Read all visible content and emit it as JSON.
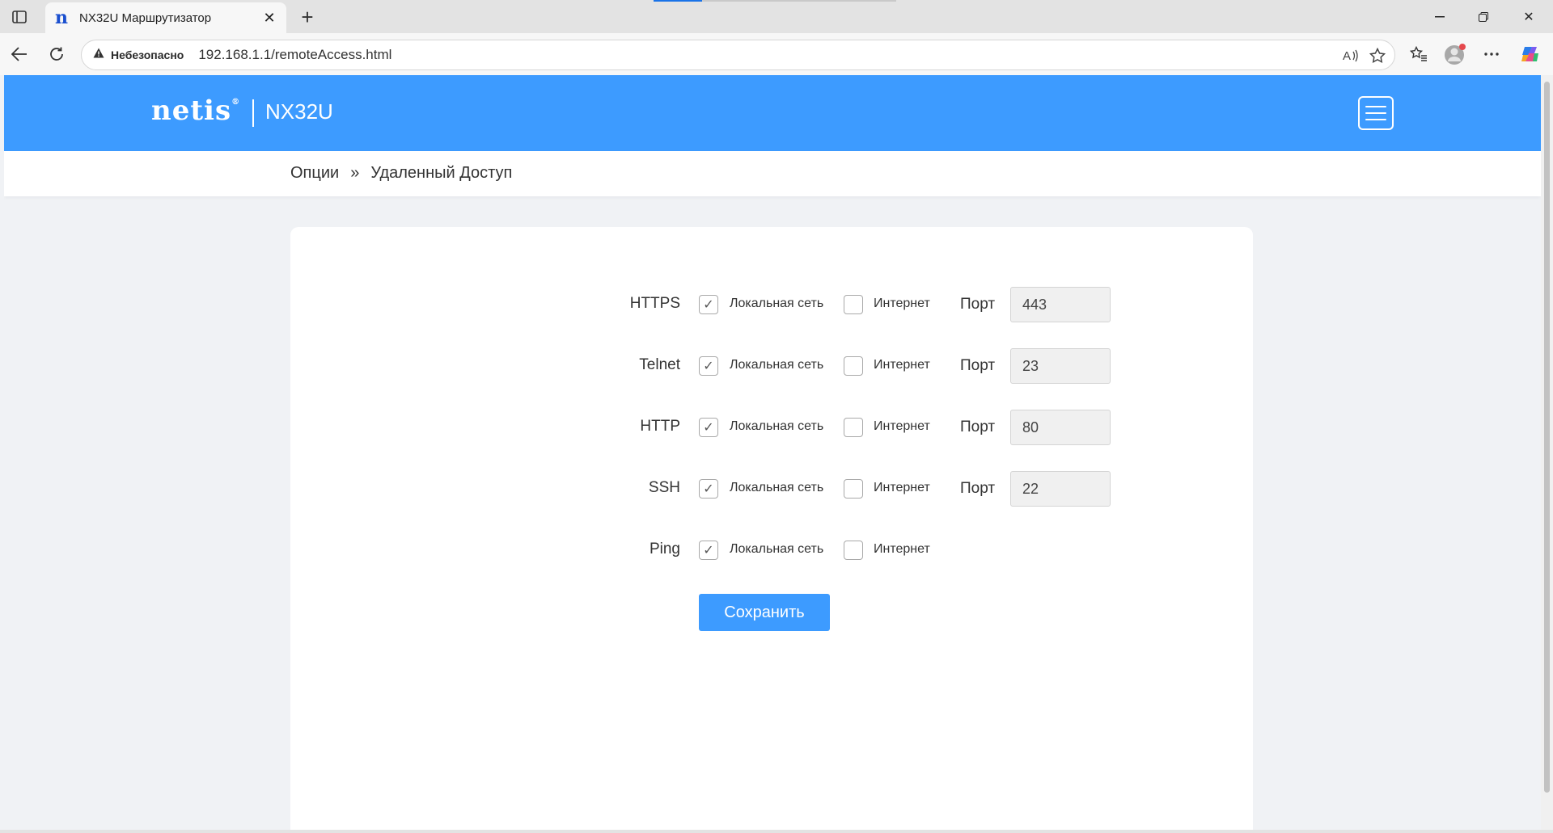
{
  "browser": {
    "tab_title": "NX32U Маршрутизатор",
    "tab_favicon": "n",
    "security_label": "Небезопасно",
    "url": "192.168.1.1/remoteAccess.html"
  },
  "header": {
    "brand": "netis",
    "brand_mark": "®",
    "model": "NX32U"
  },
  "breadcrumb": {
    "parent": "Опции",
    "separator": "»",
    "current": "Удаленный Доступ"
  },
  "form": {
    "lan_label": "Локальная сеть",
    "wan_label": "Интернет",
    "port_label": "Порт",
    "save_label": "Сохранить",
    "rows": [
      {
        "service": "HTTPS",
        "lan_checked": true,
        "wan_checked": false,
        "port": "443"
      },
      {
        "service": "Telnet",
        "lan_checked": true,
        "wan_checked": false,
        "port": "23"
      },
      {
        "service": "HTTP",
        "lan_checked": true,
        "wan_checked": false,
        "port": "80"
      },
      {
        "service": "SSH",
        "lan_checked": true,
        "wan_checked": false,
        "port": "22"
      },
      {
        "service": "Ping",
        "lan_checked": true,
        "wan_checked": false
      }
    ]
  },
  "colors": {
    "accent": "#3d9bff",
    "page_background": "#f0f2f5"
  }
}
